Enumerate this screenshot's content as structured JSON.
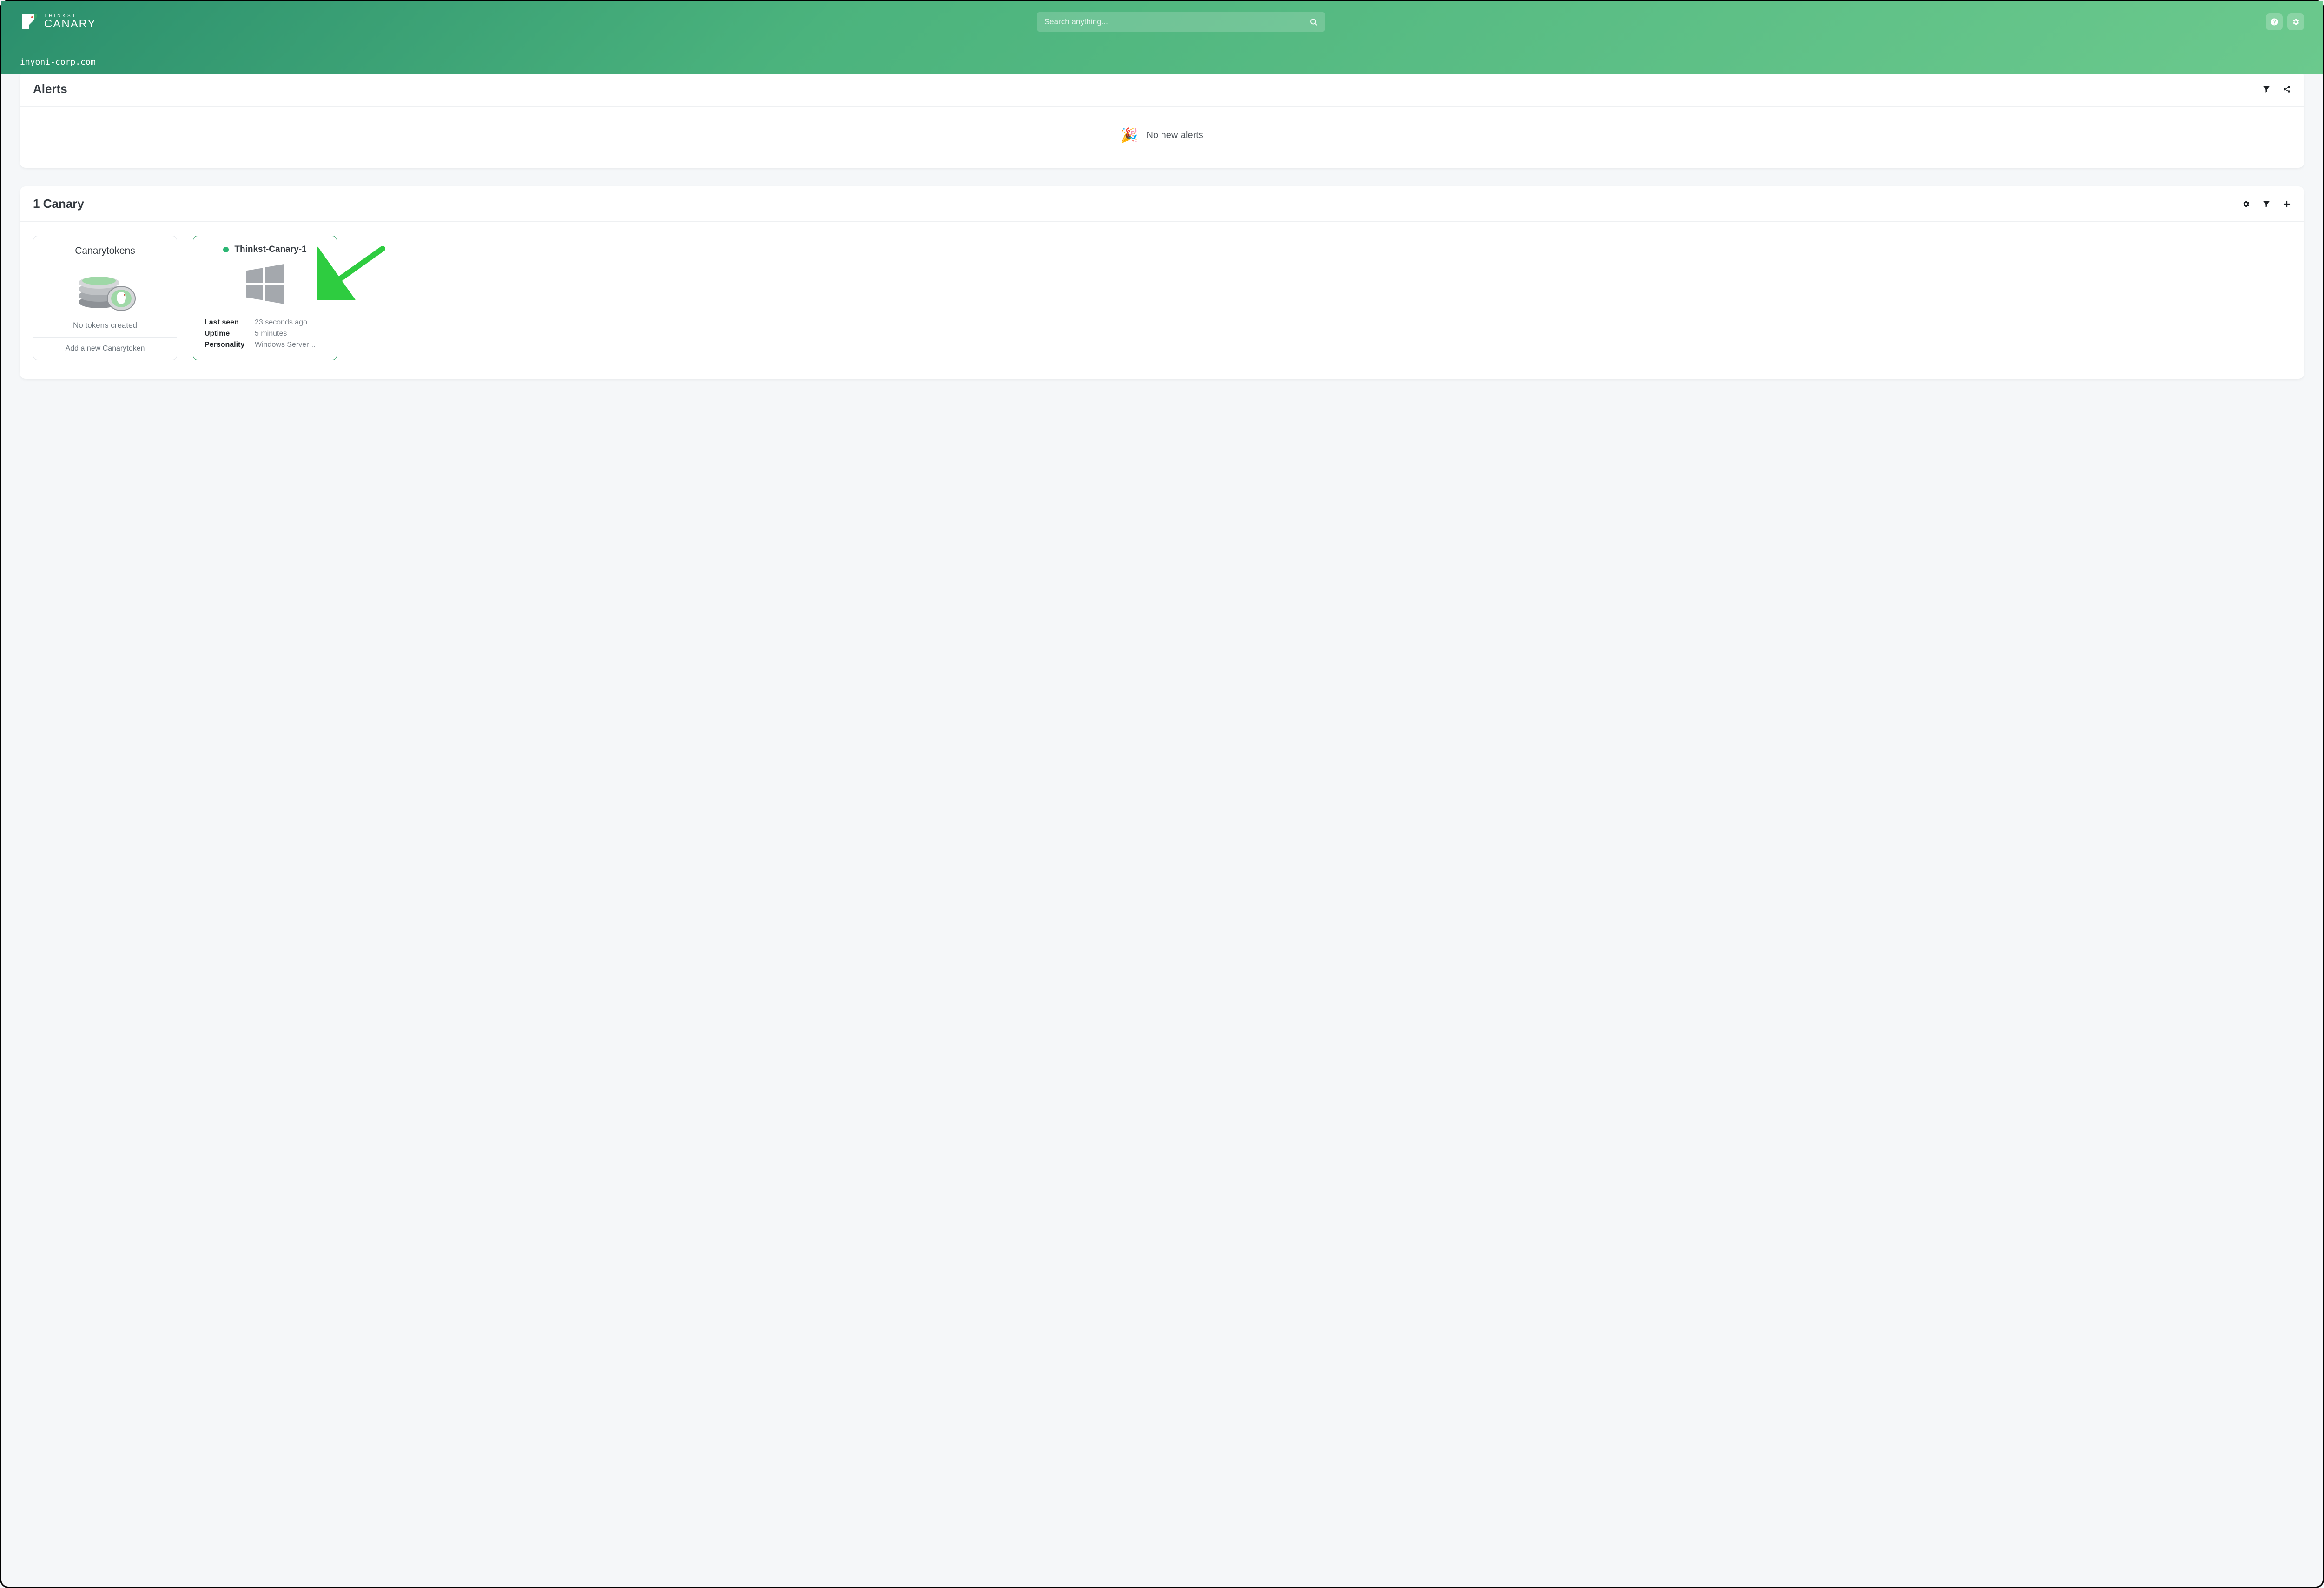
{
  "brand": {
    "small": "THINKST",
    "big": "CANARY"
  },
  "search": {
    "placeholder": "Search anything..."
  },
  "org": {
    "domain": "inyoni-corp.com"
  },
  "alerts": {
    "title": "Alerts",
    "empty_message": "No new alerts"
  },
  "canaries": {
    "title": "1 Canary",
    "tokens_card": {
      "title": "Canarytokens",
      "empty": "No tokens created",
      "add_button": "Add a new Canarytoken"
    },
    "device_card": {
      "name": "Thinkst-Canary-1",
      "status_color": "#2bb673",
      "last_seen_label": "Last seen",
      "last_seen_value": "23 seconds ago",
      "uptime_label": "Uptime",
      "uptime_value": "5 minutes",
      "personality_label": "Personality",
      "personality_value": "Windows Server …"
    }
  }
}
